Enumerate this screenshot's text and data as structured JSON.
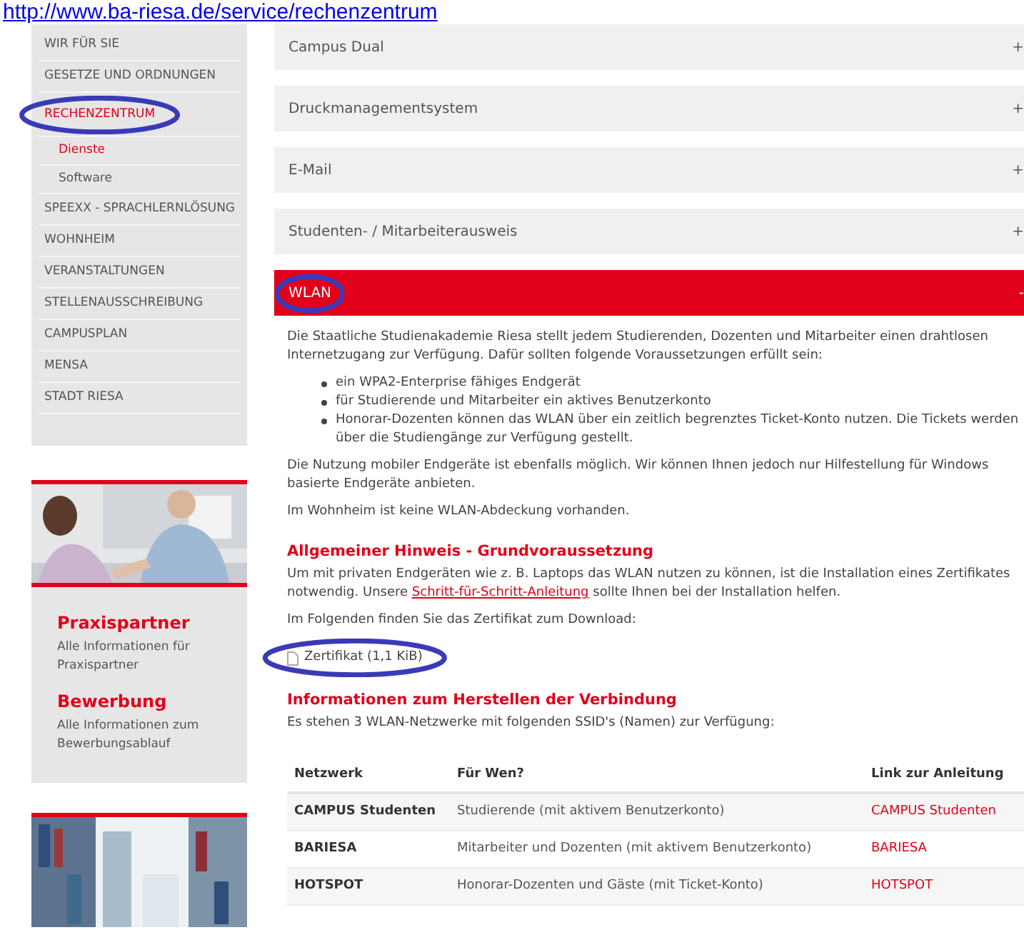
{
  "address_overlay": {
    "url": "http://www.ba-riesa.de/service/rechenzentrum"
  },
  "sidebar": {
    "items": [
      {
        "label": "WIR FÜR SIE",
        "selected": false
      },
      {
        "label": "GESETZE UND ORDNUNGEN",
        "selected": false
      },
      {
        "label": "RECHENZENTRUM",
        "selected": true,
        "children": [
          {
            "label": "Dienste",
            "selected": true
          },
          {
            "label": "Software",
            "selected": false
          }
        ]
      },
      {
        "label": "SPEEXX - SPRACHLERNLÖSUNG",
        "selected": false
      },
      {
        "label": "WOHNHEIM",
        "selected": false
      },
      {
        "label": "VERANSTALTUNGEN",
        "selected": false
      },
      {
        "label": "STELLENAUSSCHREIBUNG",
        "selected": false
      },
      {
        "label": "CAMPUSPLAN",
        "selected": false
      },
      {
        "label": "MENSA",
        "selected": false
      },
      {
        "label": "STADT RIESA",
        "selected": false
      }
    ]
  },
  "promo": {
    "links": [
      {
        "title": "Praxispartner",
        "text": "Alle Informationen für Praxispartner"
      },
      {
        "title": "Bewerbung",
        "text": "Alle Informationen zum Bewerbungsablauf"
      }
    ]
  },
  "accordion": [
    {
      "label": "Campus Dual",
      "icon": "+",
      "expanded": false
    },
    {
      "label": "Druckmanagementsystem",
      "icon": "+",
      "expanded": false
    },
    {
      "label": "E-Mail",
      "icon": "+",
      "expanded": false
    },
    {
      "label": "Studenten- / Mitarbeiterausweis",
      "icon": "+",
      "expanded": false
    },
    {
      "label": "WLAN",
      "icon": "-",
      "expanded": true
    }
  ],
  "content": {
    "intro": "Die Staatliche Studienakademie Riesa stellt jedem Studierenden, Dozenten und Mitarbeiter einen drahtlosen Internetzugang zur Verfügung. Dafür sollten folgende Voraussetzungen erfüllt sein:",
    "bullets": [
      "ein WPA2-Enterprise fähiges Endgerät",
      "für Studierende und Mitarbeiter ein aktives Benutzerkonto",
      "Honorar-Dozenten können das WLAN über ein zeitlich begrenztes Ticket-Konto nutzen. Die Tickets werden über die Studiengänge zur Verfügung gestellt."
    ],
    "mobile": "Die Nutzung mobiler Endgeräte ist ebenfalls möglich. Wir können Ihnen jedoch nur Hilfestellung für Windows basierte Endgeräte anbieten.",
    "wohnheim": "Im Wohnheim ist keine WLAN-Abdeckung vorhanden.",
    "heading_1": "Allgemeiner Hinweis - Grundvoraussetzung",
    "hint_before": "Um mit privaten Endgeräten wie z. B. Laptops das WLAN nutzen zu können, ist die Installation eines Zertifikates notwendig. Unsere",
    "hint_link": "Schritt-für-Schritt-Anleitung",
    "hint_after": "sollte Ihnen bei der Installation helfen.",
    "download_intro": "Im Folgenden finden Sie das Zertifikat zum Download:",
    "download": "Zertifikat (1,1 KiB)",
    "heading_2": "Informationen zum Herstellen der Verbindung",
    "networks_intro": "Es stehen 3 WLAN-Netzwerke mit folgenden SSID's (Namen) zur Verfügung:"
  },
  "table": {
    "columns": [
      "Netzwerk",
      "Für Wen?",
      "Link zur Anleitung"
    ],
    "rows": [
      [
        "CAMPUS Studenten",
        "Studierende (mit aktivem Benutzerkonto)",
        "CAMPUS Studenten"
      ],
      [
        "BARIESA",
        "Mitarbeiter und Dozenten (mit aktivem Benutzerkonto)",
        "BARIESA"
      ],
      [
        "HOTSPOT",
        "Honorar-Dozenten und Gäste (mit Ticket-Konto)",
        "HOTSPOT"
      ]
    ]
  }
}
